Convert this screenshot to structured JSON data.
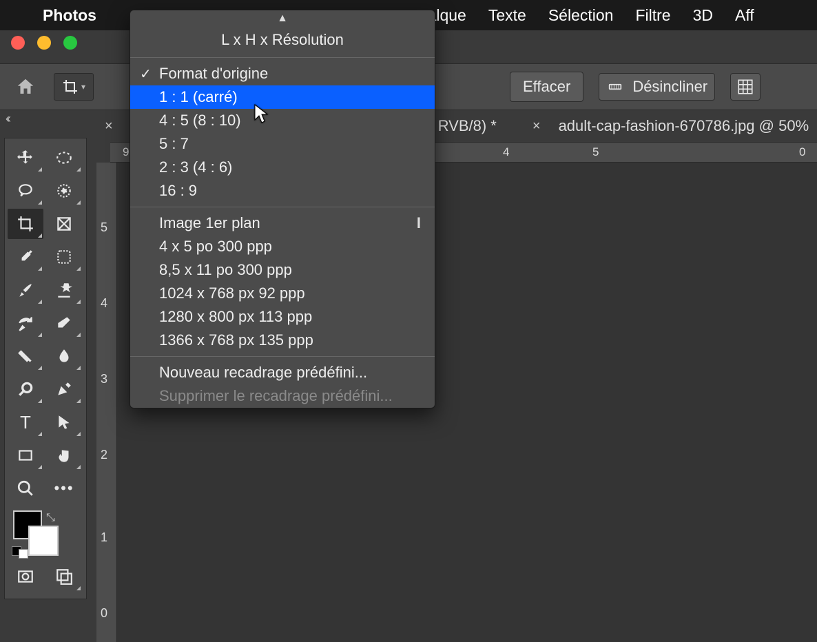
{
  "menubar": {
    "app": "Photos",
    "items": [
      "Calque",
      "Texte",
      "Sélection",
      "Filtre",
      "3D",
      "Aff"
    ]
  },
  "optbar": {
    "effacer": "Effacer",
    "desincliner": "Désincliner"
  },
  "tabs": {
    "frag1": "RVB/8) *",
    "tab2": "adult-cap-fashion-670786.jpg @ 50%"
  },
  "ruler_h": [
    "4",
    "5",
    "0"
  ],
  "ruler_h_left": "9",
  "ruler_v": [
    "5",
    "4",
    "3",
    "2",
    "1",
    "0"
  ],
  "dropdown": {
    "title": "L x H x Résolution",
    "group1_checked": "Format d'origine",
    "group1": [
      "1 : 1 (carré)",
      "4 : 5 (8 : 10)",
      "5 : 7",
      "2 : 3 (4 : 6)",
      "16 : 9"
    ],
    "group2_first": {
      "label": "Image 1er plan",
      "shortcut": "I"
    },
    "group2": [
      "4 x 5 po 300 ppp",
      "8,5 x 11 po 300 ppp",
      "1024 x 768 px 92 ppp",
      "1280 x 800 px 113 ppp",
      "1366 x 768 px 135 ppp"
    ],
    "group3_new": "Nouveau recadrage prédéfini...",
    "group3_del": "Supprimer le recadrage prédéfini..."
  }
}
